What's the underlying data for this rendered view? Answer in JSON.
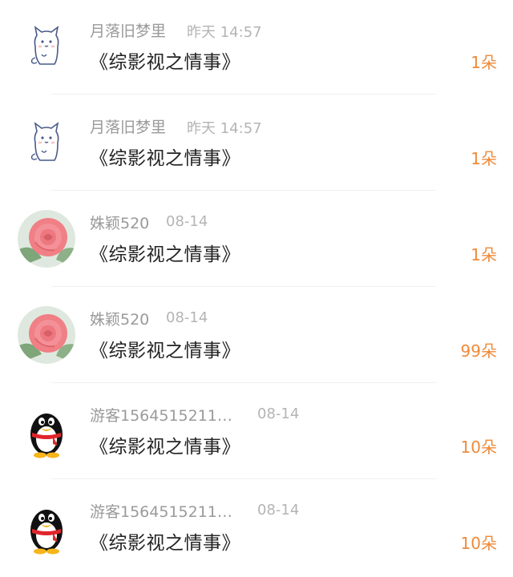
{
  "gifts": [
    {
      "user": "月落旧梦里",
      "time": "昨天 14:57",
      "book": "《综影视之情事》",
      "count": "1朵",
      "avatar": "cat-avatar"
    },
    {
      "user": "月落旧梦里",
      "time": "昨天 14:57",
      "book": "《综影视之情事》",
      "count": "1朵",
      "avatar": "cat-avatar"
    },
    {
      "user": "姝颖520",
      "time": "08-14",
      "book": "《综影视之情事》",
      "count": "1朵",
      "avatar": "rose-avatar"
    },
    {
      "user": "姝颖520",
      "time": "08-14",
      "book": "《综影视之情事》",
      "count": "99朵",
      "avatar": "rose-avatar"
    },
    {
      "user": "游客1564515211…",
      "time": "08-14",
      "book": "《综影视之情事》",
      "count": "10朵",
      "avatar": "penguin-avatar"
    },
    {
      "user": "游客1564515211…",
      "time": "08-14",
      "book": "《综影视之情事》",
      "count": "10朵",
      "avatar": "penguin-avatar"
    }
  ],
  "colors": {
    "accent": "#ee8a3a",
    "name": "#9a9a9a",
    "title": "#222222"
  }
}
